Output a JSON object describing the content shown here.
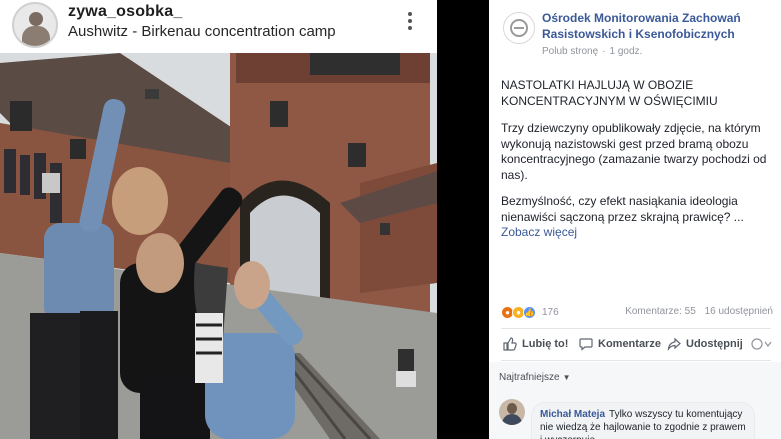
{
  "instagram": {
    "username": "zywa_osobka_",
    "location": "Aushwitz - Birkenau concentration camp"
  },
  "facebook": {
    "page_name": "Ośrodek Monitorowania Zachowań Rasistowskich i Ksenofobicznych",
    "like_page": "Polub stronę",
    "time": "1 godz.",
    "headline": "NASTOLATKI HAJLUJĄ W OBOZIE KONCENTRACYJNYM W OŚWIĘCIMIU",
    "paragraph1": "Trzy dziewczyny opublikowały zdjęcie, na którym wykonują nazistowski gest przed bramą obozu koncentracyjnego (zamazanie twarzy pochodzi od nas).",
    "paragraph2": "Bezmyślność, czy efekt nasiąkania ideologia nienawiści sączoną przez skrajną prawicę?",
    "paragraph2_ellipsis": "...",
    "see_more": "Zobacz więcej",
    "reaction_count": "176",
    "comments_count": "Komentarze: 55",
    "shares_count": "16 udostępnień",
    "actions": {
      "like": "Lubię to!",
      "comment": "Komentarze",
      "share": "Udostępnij"
    },
    "sort_label": "Najtrafniejsze",
    "comment": {
      "author": "Michał Mateja",
      "text": "Tylko wszyscy tu komentujący nie wiedzą że hajlowanie to zgodnie z prawem i wyczerpuje..."
    },
    "colors": {
      "link": "#3b5998",
      "text": "#1d2129",
      "muted": "#90949c"
    }
  }
}
